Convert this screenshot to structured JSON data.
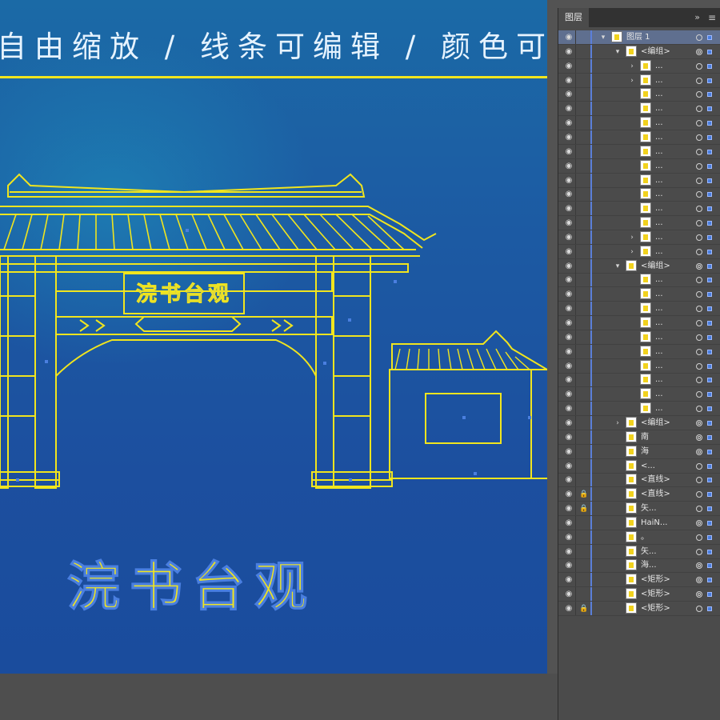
{
  "headline": "自由缩放 / 线条可编辑 / 颜色可替换",
  "artwork": {
    "signboard_text": "浣书台观",
    "calligraphy_text": "浣书台观",
    "colors": {
      "background_top": "#1b6aa6",
      "background_bottom": "#1a4c9d",
      "line": "#f1e51e",
      "outline": "#8fc9b4",
      "anchor": "#4a7fe0"
    }
  },
  "panel": {
    "tab_label": "图层",
    "collapse_icon": "double-chevron-right-icon",
    "menu_icon": "hamburger-menu-icon",
    "rows": [
      {
        "label": "图层 1",
        "indent": 0,
        "arrow": "expanded",
        "lock": false,
        "selected": true,
        "target": "single"
      },
      {
        "label": "<编组>",
        "indent": 1,
        "arrow": "expanded",
        "lock": false,
        "target": "double"
      },
      {
        "label": "...",
        "indent": 2,
        "arrow": "collapsed",
        "lock": false,
        "target": "single"
      },
      {
        "label": "...",
        "indent": 2,
        "arrow": "collapsed",
        "lock": false,
        "target": "single"
      },
      {
        "label": "...",
        "indent": 2,
        "arrow": "none",
        "lock": false,
        "target": "single"
      },
      {
        "label": "...",
        "indent": 2,
        "arrow": "none",
        "lock": false,
        "target": "single"
      },
      {
        "label": "...",
        "indent": 2,
        "arrow": "none",
        "lock": false,
        "target": "single"
      },
      {
        "label": "...",
        "indent": 2,
        "arrow": "none",
        "lock": false,
        "target": "single"
      },
      {
        "label": "...",
        "indent": 2,
        "arrow": "none",
        "lock": false,
        "target": "single"
      },
      {
        "label": "...",
        "indent": 2,
        "arrow": "none",
        "lock": false,
        "target": "single"
      },
      {
        "label": "...",
        "indent": 2,
        "arrow": "none",
        "lock": false,
        "target": "single"
      },
      {
        "label": "...",
        "indent": 2,
        "arrow": "none",
        "lock": false,
        "target": "single"
      },
      {
        "label": "...",
        "indent": 2,
        "arrow": "none",
        "lock": false,
        "target": "single"
      },
      {
        "label": "...",
        "indent": 2,
        "arrow": "none",
        "lock": false,
        "target": "single"
      },
      {
        "label": "...",
        "indent": 2,
        "arrow": "collapsed",
        "lock": false,
        "target": "single"
      },
      {
        "label": "...",
        "indent": 2,
        "arrow": "collapsed",
        "lock": false,
        "target": "single"
      },
      {
        "label": "<编组>",
        "indent": 1,
        "arrow": "expanded",
        "lock": false,
        "target": "double"
      },
      {
        "label": "...",
        "indent": 2,
        "arrow": "none",
        "lock": false,
        "target": "single"
      },
      {
        "label": "...",
        "indent": 2,
        "arrow": "none",
        "lock": false,
        "target": "single"
      },
      {
        "label": "...",
        "indent": 2,
        "arrow": "none",
        "lock": false,
        "target": "single"
      },
      {
        "label": "...",
        "indent": 2,
        "arrow": "none",
        "lock": false,
        "target": "single"
      },
      {
        "label": "...",
        "indent": 2,
        "arrow": "none",
        "lock": false,
        "target": "single"
      },
      {
        "label": "...",
        "indent": 2,
        "arrow": "none",
        "lock": false,
        "target": "single"
      },
      {
        "label": "...",
        "indent": 2,
        "arrow": "none",
        "lock": false,
        "target": "single"
      },
      {
        "label": "...",
        "indent": 2,
        "arrow": "none",
        "lock": false,
        "target": "single"
      },
      {
        "label": "...",
        "indent": 2,
        "arrow": "none",
        "lock": false,
        "target": "single"
      },
      {
        "label": "...",
        "indent": 2,
        "arrow": "none",
        "lock": false,
        "target": "single"
      },
      {
        "label": "<编组>",
        "indent": 1,
        "arrow": "collapsed",
        "lock": false,
        "target": "double"
      },
      {
        "label": "南",
        "indent": 1,
        "arrow": "none",
        "lock": false,
        "target": "double"
      },
      {
        "label": "海",
        "indent": 1,
        "arrow": "none",
        "lock": false,
        "target": "double"
      },
      {
        "label": "<...",
        "indent": 1,
        "arrow": "none",
        "lock": false,
        "target": "single"
      },
      {
        "label": "<直线>",
        "indent": 1,
        "arrow": "none",
        "lock": false,
        "target": "single"
      },
      {
        "label": "<直线>",
        "indent": 1,
        "arrow": "none",
        "lock": true,
        "target": "single"
      },
      {
        "label": "矢...",
        "indent": 1,
        "arrow": "none",
        "lock": true,
        "target": "single"
      },
      {
        "label": "HaiN...",
        "indent": 1,
        "arrow": "none",
        "lock": false,
        "target": "double"
      },
      {
        "label": "。",
        "indent": 1,
        "arrow": "none",
        "lock": false,
        "target": "single"
      },
      {
        "label": "矢...",
        "indent": 1,
        "arrow": "none",
        "lock": false,
        "target": "single"
      },
      {
        "label": "海...",
        "indent": 1,
        "arrow": "none",
        "lock": false,
        "target": "double"
      },
      {
        "label": "<矩形>",
        "indent": 1,
        "arrow": "none",
        "lock": false,
        "target": "double"
      },
      {
        "label": "<矩形>",
        "indent": 1,
        "arrow": "none",
        "lock": false,
        "target": "double"
      },
      {
        "label": "<矩形>",
        "indent": 1,
        "arrow": "none",
        "lock": true,
        "target": "single"
      }
    ]
  }
}
